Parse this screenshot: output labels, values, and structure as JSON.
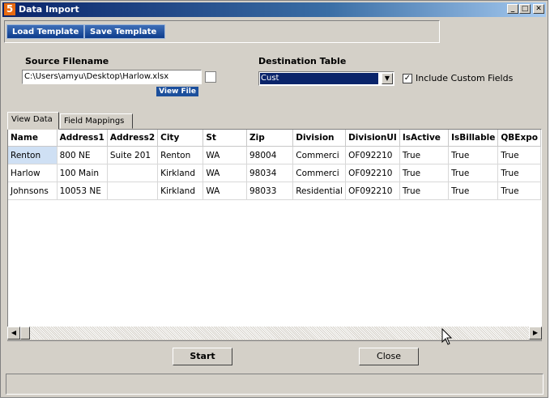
{
  "window": {
    "title": "Data Import",
    "icon": "app-icon",
    "app_icon_glyph": "5"
  },
  "titlebar_buttons": {
    "minimize": "_",
    "maximize": "□",
    "close": "✕"
  },
  "toolbar": {
    "load_template": "Load Template",
    "save_template": "Save Template"
  },
  "source": {
    "label": "Source Filename",
    "value": "C:\\Users\\amyu\\Desktop\\Harlow.xlsx",
    "view_file": "View File"
  },
  "destination": {
    "label": "Destination Table",
    "value": "Cust",
    "include_custom_fields_label": "Include Custom Fields",
    "include_custom_fields_checked": true
  },
  "tabs": [
    {
      "label": "View Data",
      "active": true
    },
    {
      "label": "Field Mappings",
      "active": false
    }
  ],
  "grid": {
    "columns": [
      "Name",
      "Address1",
      "Address2",
      "City",
      "St",
      "Zip",
      "Division",
      "DivisionUI",
      "IsActive",
      "IsBillable",
      "QBExpo"
    ],
    "rows": [
      [
        "Renton",
        "800 NE",
        "Suite 201",
        "Renton",
        "WA",
        "98004",
        "Commerci",
        "OF092210",
        "True",
        "True",
        "True"
      ],
      [
        "Harlow",
        "100 Main",
        "",
        "Kirkland",
        "WA",
        "98034",
        "Commerci",
        "OF092210",
        "True",
        "True",
        "True"
      ],
      [
        "Johnsons",
        "10053 NE",
        "",
        "Kirkland",
        "WA",
        "98033",
        "Residential",
        "OF092210",
        "True",
        "True",
        "True"
      ]
    ]
  },
  "buttons": {
    "start": "Start",
    "close": "Close"
  },
  "colors": {
    "accent": "#0a246a",
    "button_blue": "#1c4f9c",
    "face": "#d4d0c8"
  }
}
